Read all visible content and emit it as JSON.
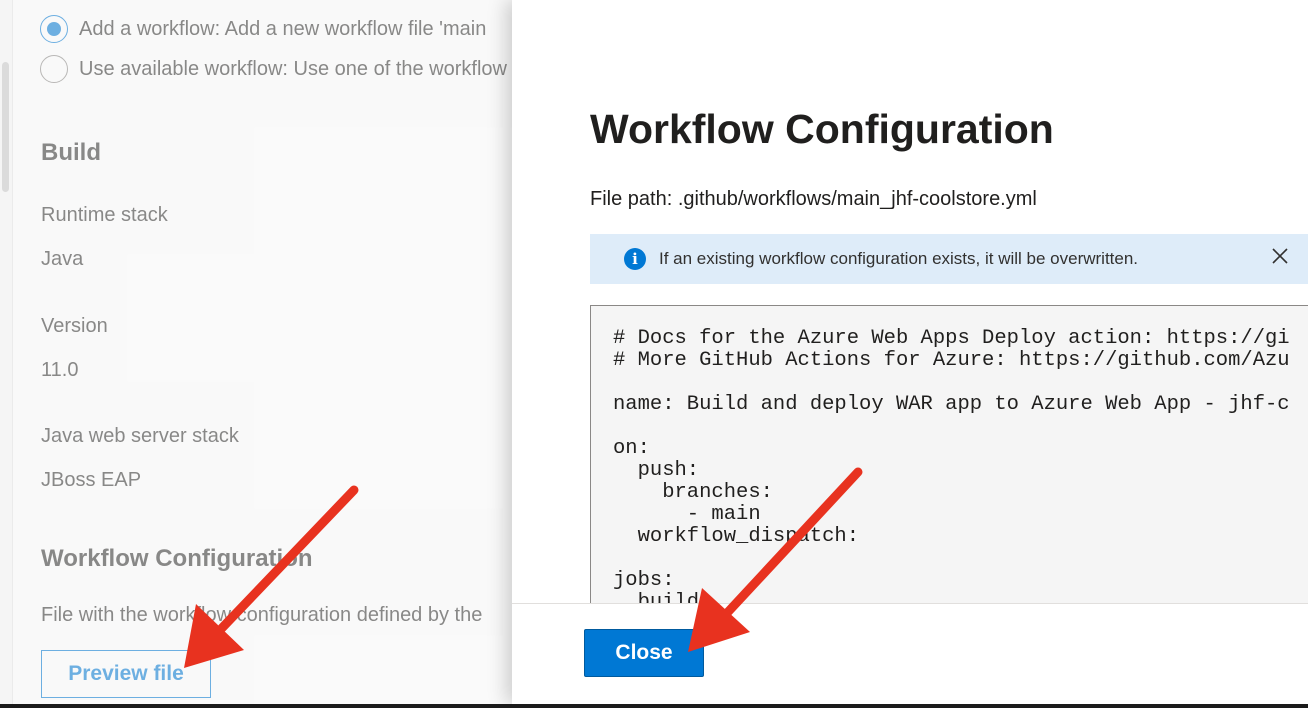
{
  "left_page": {
    "workflow_options": [
      {
        "label": "Add a workflow: Add a new workflow file 'main",
        "checked": true
      },
      {
        "label": "Use available workflow: Use one of the workflow",
        "checked": false
      }
    ],
    "build": {
      "section_title": "Build",
      "fields": [
        {
          "label": "Runtime stack",
          "value": "Java"
        },
        {
          "label": "Version",
          "value": "11.0"
        },
        {
          "label": "Java web server stack",
          "value": "JBoss EAP"
        }
      ]
    },
    "workflow_config": {
      "section_title": "Workflow Configuration",
      "description": "File with the workflow configuration defined by the",
      "preview_button": "Preview file"
    }
  },
  "dialog": {
    "title": "Workflow Configuration",
    "file_path": "File path: .github/workflows/main_jhf-coolstore.yml",
    "info_message": "If an existing workflow configuration exists, it will be overwritten.",
    "info_icon": "info-icon",
    "dismiss_icon": "close-icon",
    "code_lines": [
      "# Docs for the Azure Web Apps Deploy action: https://gi",
      "# More GitHub Actions for Azure: https://github.com/Azu",
      "",
      "name: Build and deploy WAR app to Azure Web App - jhf-c",
      "",
      "on:",
      "  push:",
      "    branches:",
      "      - main",
      "  workflow_dispatch:",
      "",
      "jobs:",
      "  build:"
    ],
    "close_button": "Close"
  },
  "colors": {
    "accent": "#0078d4",
    "info_bar": "#deecf9",
    "arrow": "#e8321f",
    "code_background": "#f5f5f5"
  }
}
